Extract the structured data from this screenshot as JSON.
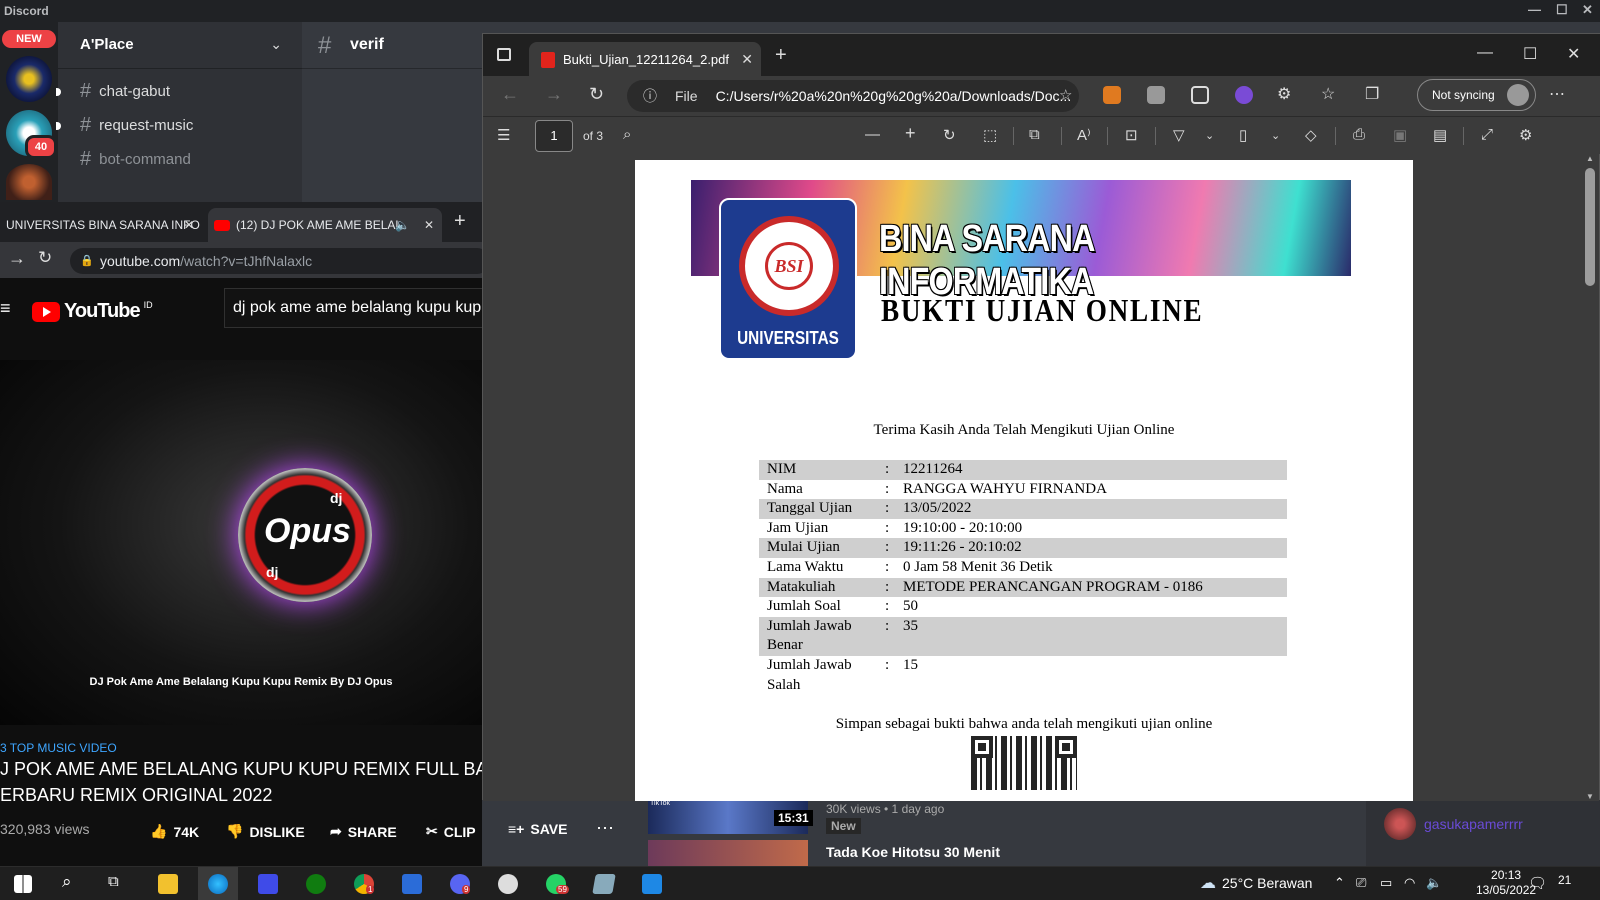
{
  "discord": {
    "app_title": "Discord",
    "new_badge": "NEW",
    "guild_mention_count": "40",
    "server_name": "A'Place",
    "channels": [
      {
        "name": "chat-gabut",
        "unread": true
      },
      {
        "name": "request-music",
        "unread": true
      },
      {
        "name": "bot-command",
        "unread": false
      }
    ],
    "active_channel": "verif",
    "member_name": "gasukapamerrrr"
  },
  "youtube": {
    "tabs": [
      {
        "label": "UNIVERSITAS BINA SARANA INFO"
      },
      {
        "label": "(12) DJ POK AME AME BELAL"
      }
    ],
    "url_host": "youtube.com",
    "url_path": "/watch?v=tJhfNalaxlc",
    "logo_text": "YouTube",
    "logo_region": "ID",
    "search_value": "dj pok ame ame belalang kupu kupu",
    "video_logo_text": "Opus",
    "video_logo_top": "dj",
    "video_logo_bottom": "dj",
    "video_caption": "DJ Pok Ame Ame Belalang Kupu Kupu Remix By DJ Opus",
    "hashtag_line": "3 TOP MUSIC VIDEO",
    "title_line1": "J POK AME AME BELALANG KUPU KUPU REMIX FULL BASS",
    "title_line2": "ERBARU REMIX ORIGINAL 2022",
    "views": "320,983 views",
    "actions": {
      "like": "74K",
      "dislike": "DISLIKE",
      "share": "SHARE",
      "clip": "CLIP",
      "save": "SAVE"
    },
    "recommendation1": {
      "views": "30K views • 1 day ago",
      "badge": "New",
      "duration": "15:31",
      "channel_icon": "TikTok"
    },
    "recommendation2": {
      "title": "Tada Koe Hitotsu 30 Menit"
    }
  },
  "edge": {
    "tab_title": "Bukti_Ujian_12211264_2.pdf",
    "url_scheme": "File",
    "url": "C:/Users/r%20a%20n%20g%20g%20a/Downloads/Doc...",
    "sync_label": "Not syncing",
    "page_current": "1",
    "page_total": "of 3"
  },
  "pdf": {
    "banner_title": "BINA SARANA INFORMATIKA",
    "banner_subtitle": "BUKTI  UJIAN  ONLINE",
    "logo_text": "UNIVERSITAS",
    "logo_ring_text": "BINA SARANA INFORMATIKA",
    "logo_initials": "BSI",
    "thanks": "Terima Kasih Anda Telah Mengikuti Ujian Online",
    "rows": [
      {
        "key": "NIM",
        "value": "12211264"
      },
      {
        "key": "Nama",
        "value": "RANGGA WAHYU FIRNANDA"
      },
      {
        "key": "Tanggal Ujian",
        "value": "13/05/2022"
      },
      {
        "key": "Jam Ujian",
        "value": "19:10:00 - 20:10:00"
      },
      {
        "key": "Mulai Ujian",
        "value": "19:11:26 - 20:10:02"
      },
      {
        "key": "Lama Waktu",
        "value": "0 Jam 58 Menit 36 Detik"
      },
      {
        "key": "Matakuliah",
        "value": "METODE PERANCANGAN PROGRAM - 0186"
      },
      {
        "key": "Jumlah Soal",
        "value": "50"
      },
      {
        "key": "Jumlah Jawab Benar",
        "value": "35"
      },
      {
        "key": "Jumlah Jawab Salah",
        "value": "15"
      }
    ],
    "save_note": "Simpan sebagai bukti bahwa anda telah mengikuti ujian online"
  },
  "taskbar": {
    "weather": "25°C  Berawan",
    "time": "20:13",
    "date": "13/05/2022",
    "notification_count": "21",
    "chrome_badge": "1",
    "discord_badge": "9",
    "whatsapp_badge": "59"
  }
}
